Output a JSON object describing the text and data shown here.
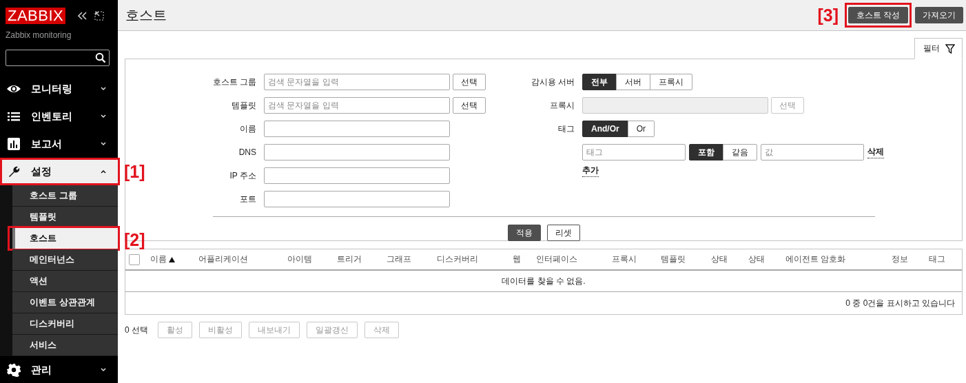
{
  "sidebar": {
    "logo": "ZABBIX",
    "subtitle": "Zabbix monitoring",
    "menu": [
      {
        "label": "모니터링",
        "expanded": false
      },
      {
        "label": "인벤토리",
        "expanded": false
      },
      {
        "label": "보고서",
        "expanded": false
      },
      {
        "label": "설정",
        "expanded": true,
        "callout": "[1]",
        "children": [
          {
            "label": "호스트 그룹",
            "selected": false
          },
          {
            "label": "템플릿",
            "selected": false
          },
          {
            "label": "호스트",
            "selected": true,
            "callout": "[2]"
          },
          {
            "label": "메인터넌스",
            "selected": false
          },
          {
            "label": "액션",
            "selected": false
          },
          {
            "label": "이벤트 상관관계",
            "selected": false
          },
          {
            "label": "디스커버리",
            "selected": false
          },
          {
            "label": "서비스",
            "selected": false
          }
        ]
      },
      {
        "label": "관리",
        "expanded": false
      }
    ]
  },
  "header": {
    "title": "호스트",
    "buttons": [
      {
        "label": "호스트 작성",
        "callout": "[3]"
      },
      {
        "label": "가져오기"
      }
    ]
  },
  "filter": {
    "tab": "필터",
    "left_fields": [
      {
        "label": "호스트 그룹",
        "kind": "multiselect",
        "placeholder": "검색 문자열을 입력",
        "button": "선택"
      },
      {
        "label": "템플릿",
        "kind": "multiselect",
        "placeholder": "검색 문자열을 입력",
        "button": "선택"
      },
      {
        "label": "이름",
        "kind": "text"
      },
      {
        "label": "DNS",
        "kind": "text"
      },
      {
        "label": "IP 주소",
        "kind": "text"
      },
      {
        "label": "포트",
        "kind": "text"
      }
    ],
    "monitored_by": {
      "label": "감시용 서버",
      "options": [
        {
          "label": "전부",
          "selected": true
        },
        {
          "label": "서버",
          "selected": false
        },
        {
          "label": "프록시",
          "selected": false
        }
      ]
    },
    "proxy": {
      "label": "프록시",
      "disabled": true,
      "button": "선택"
    },
    "tags": {
      "label": "태그",
      "operator": [
        {
          "label": "And/Or",
          "selected": true
        },
        {
          "label": "Or",
          "selected": false
        }
      ],
      "rows": [
        {
          "placeholder": "태그",
          "match": [
            {
              "label": "포함",
              "selected": true
            },
            {
              "label": "같음",
              "selected": false
            }
          ],
          "value_placeholder": "값",
          "remove": "삭제"
        }
      ],
      "add": "추가"
    },
    "actions": [
      {
        "label": "적용",
        "primary": true
      },
      {
        "label": "리셋",
        "primary": false
      }
    ]
  },
  "table": {
    "select_all": {
      "checked": false
    },
    "columns": [
      {
        "label": "이름",
        "sorted": true
      },
      {
        "label": "어플리케이션",
        "sorted": false
      },
      {
        "label": "아이템",
        "sorted": false
      },
      {
        "label": "트리거",
        "sorted": false
      },
      {
        "label": "그래프",
        "sorted": false
      },
      {
        "label": "디스커버리",
        "sorted": false
      },
      {
        "label": "웹",
        "sorted": false
      },
      {
        "label": "인터페이스",
        "sorted": false
      },
      {
        "label": "프록시",
        "sorted": false
      },
      {
        "label": "템플릿",
        "sorted": false
      },
      {
        "label": "상태",
        "sorted": false
      },
      {
        "label": "상태",
        "sorted": false
      },
      {
        "label": "에이전트 암호화",
        "sorted": false
      },
      {
        "label": "정보",
        "sorted": false
      },
      {
        "label": "태그",
        "sorted": false
      }
    ],
    "empty_message": "데이터를 찾을 수 없음.",
    "summary": "0 중 0건을 표시하고 있습니다"
  },
  "mass_actions": {
    "selected_count": "0 선택",
    "buttons": [
      {
        "label": "활성",
        "disabled": true
      },
      {
        "label": "비활성",
        "disabled": true
      },
      {
        "label": "내보내기",
        "disabled": true
      },
      {
        "label": "일괄갱신",
        "disabled": true
      },
      {
        "label": "삭제",
        "disabled": true
      }
    ]
  }
}
